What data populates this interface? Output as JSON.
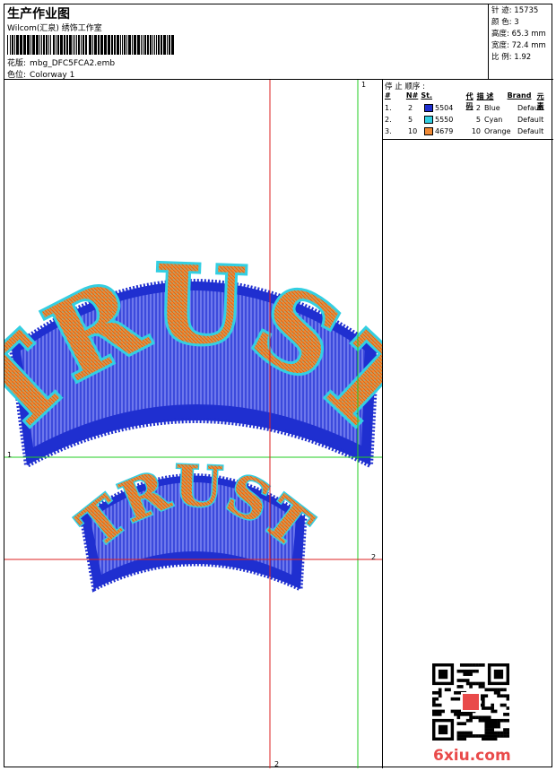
{
  "header": {
    "title": "生产作业图",
    "studio": "Wilcom(汇泉) 绣饰工作室",
    "design_label": "花版:",
    "design_file": "mbg_DFC5FCA2.emb",
    "colorway_label": "色位:",
    "colorway": "Colorway 1"
  },
  "stats": {
    "stitches_label": "针 迹:",
    "stitches": "15735",
    "colors_label": "颜 色:",
    "colors": "3",
    "height_label": "高度:",
    "height": "65.3 mm",
    "width_label": "宽度:",
    "width": "72.4 mm",
    "scale_label": "比 例:",
    "scale": "1.92"
  },
  "stop_sequence": {
    "title": "停 止 顺序 :",
    "columns": [
      "#",
      "N#",
      "St.",
      "代 码",
      "描 述",
      "Brand",
      "元 素"
    ],
    "rows": [
      {
        "idx": "1.",
        "n": "2",
        "stitches": "5504",
        "code": "2",
        "desc": "Blue",
        "brand": "Default",
        "color": "#1f2fd0"
      },
      {
        "idx": "2.",
        "n": "5",
        "stitches": "5550",
        "code": "5",
        "desc": "Cyan",
        "brand": "Default",
        "color": "#33cfe2"
      },
      {
        "idx": "3.",
        "n": "10",
        "stitches": "4679",
        "code": "10",
        "desc": "Orange",
        "brand": "Default",
        "color": "#f08a35"
      }
    ]
  },
  "canvas": {
    "guide_v_green": "1",
    "guide_h_green": "1",
    "guide_h_red": "2",
    "guide_v_red": "2",
    "design_large_text": "TRUST",
    "design_small_text": "TRUST"
  },
  "footer": {
    "brandmark": "6xiu.com"
  },
  "colors": {
    "blue": "#1f2fd0",
    "cyan": "#33cfe2",
    "orange": "#f08a35",
    "guide_green": "#22cc22",
    "guide_red": "#dd2222"
  }
}
